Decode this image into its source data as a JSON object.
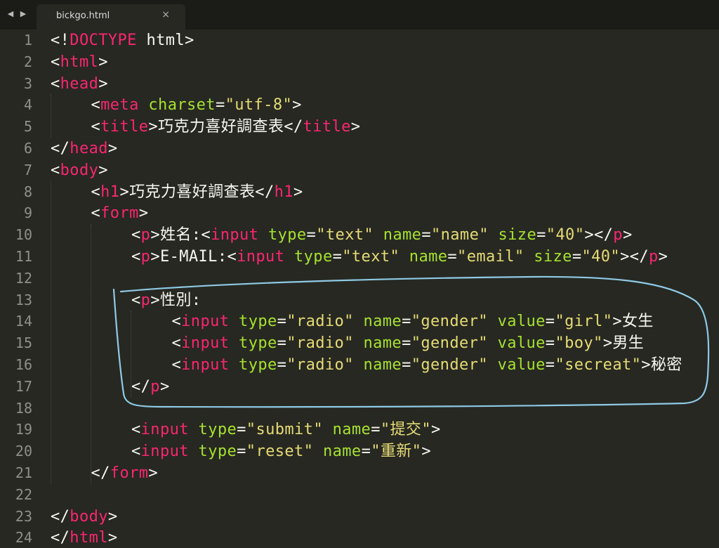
{
  "tab": {
    "title": "bickgo.html",
    "close": "×"
  },
  "nav": {
    "back": "◀",
    "forward": "▶"
  },
  "editor": {
    "lines": [
      {
        "n": "1",
        "indent": 0,
        "tokens": [
          [
            "<!",
            "pl"
          ],
          [
            "DOCTYPE",
            "tg"
          ],
          [
            " html>",
            "pl"
          ]
        ]
      },
      {
        "n": "2",
        "indent": 0,
        "tokens": [
          [
            "<",
            "pl"
          ],
          [
            "html",
            "tg"
          ],
          [
            ">",
            "pl"
          ]
        ]
      },
      {
        "n": "3",
        "indent": 0,
        "tokens": [
          [
            "<",
            "pl"
          ],
          [
            "head",
            "tg"
          ],
          [
            ">",
            "pl"
          ]
        ]
      },
      {
        "n": "4",
        "indent": 1,
        "tokens": [
          [
            "<",
            "pl"
          ],
          [
            "meta",
            "tg"
          ],
          [
            " ",
            "pl"
          ],
          [
            "charset",
            "at"
          ],
          [
            "=",
            "pl"
          ],
          [
            "\"utf-8\"",
            "st"
          ],
          [
            ">",
            "pl"
          ]
        ]
      },
      {
        "n": "5",
        "indent": 1,
        "tokens": [
          [
            "<",
            "pl"
          ],
          [
            "title",
            "tg"
          ],
          [
            ">巧克力喜好調查表</",
            "pl"
          ],
          [
            "title",
            "tg"
          ],
          [
            ">",
            "pl"
          ]
        ]
      },
      {
        "n": "6",
        "indent": 0,
        "tokens": [
          [
            "</",
            "pl"
          ],
          [
            "head",
            "tg"
          ],
          [
            ">",
            "pl"
          ]
        ]
      },
      {
        "n": "7",
        "indent": 0,
        "tokens": [
          [
            "<",
            "pl"
          ],
          [
            "body",
            "tg"
          ],
          [
            ">",
            "pl"
          ]
        ]
      },
      {
        "n": "8",
        "indent": 1,
        "tokens": [
          [
            "<",
            "pl"
          ],
          [
            "h1",
            "tg"
          ],
          [
            ">巧克力喜好調查表</",
            "pl"
          ],
          [
            "h1",
            "tg"
          ],
          [
            ">",
            "pl"
          ]
        ]
      },
      {
        "n": "9",
        "indent": 1,
        "tokens": [
          [
            "<",
            "pl"
          ],
          [
            "form",
            "tg"
          ],
          [
            ">",
            "pl"
          ]
        ]
      },
      {
        "n": "10",
        "indent": 2,
        "tokens": [
          [
            "<",
            "pl"
          ],
          [
            "p",
            "tg"
          ],
          [
            ">姓名:<",
            "pl"
          ],
          [
            "input",
            "tg"
          ],
          [
            " ",
            "pl"
          ],
          [
            "type",
            "at"
          ],
          [
            "=",
            "pl"
          ],
          [
            "\"text\"",
            "st"
          ],
          [
            " ",
            "pl"
          ],
          [
            "name",
            "at"
          ],
          [
            "=",
            "pl"
          ],
          [
            "\"name\"",
            "st"
          ],
          [
            " ",
            "pl"
          ],
          [
            "size",
            "at"
          ],
          [
            "=",
            "pl"
          ],
          [
            "\"40\"",
            "st"
          ],
          [
            "></",
            "pl"
          ],
          [
            "p",
            "tg"
          ],
          [
            ">",
            "pl"
          ]
        ]
      },
      {
        "n": "11",
        "indent": 2,
        "tokens": [
          [
            "<",
            "pl"
          ],
          [
            "p",
            "tg"
          ],
          [
            ">E-MAIL:<",
            "pl"
          ],
          [
            "input",
            "tg"
          ],
          [
            " ",
            "pl"
          ],
          [
            "type",
            "at"
          ],
          [
            "=",
            "pl"
          ],
          [
            "\"text\"",
            "st"
          ],
          [
            " ",
            "pl"
          ],
          [
            "name",
            "at"
          ],
          [
            "=",
            "pl"
          ],
          [
            "\"email\"",
            "st"
          ],
          [
            " ",
            "pl"
          ],
          [
            "size",
            "at"
          ],
          [
            "=",
            "pl"
          ],
          [
            "\"40\"",
            "st"
          ],
          [
            "></",
            "pl"
          ],
          [
            "p",
            "tg"
          ],
          [
            ">",
            "pl"
          ]
        ]
      },
      {
        "n": "12",
        "indent": 0,
        "tokens": []
      },
      {
        "n": "13",
        "indent": 2,
        "tokens": [
          [
            "<",
            "pl"
          ],
          [
            "p",
            "tg"
          ],
          [
            ">性別:",
            "pl"
          ]
        ]
      },
      {
        "n": "14",
        "indent": 3,
        "tokens": [
          [
            "<",
            "pl"
          ],
          [
            "input",
            "tg"
          ],
          [
            " ",
            "pl"
          ],
          [
            "type",
            "at"
          ],
          [
            "=",
            "pl"
          ],
          [
            "\"radio\"",
            "st"
          ],
          [
            " ",
            "pl"
          ],
          [
            "name",
            "at"
          ],
          [
            "=",
            "pl"
          ],
          [
            "\"gender\"",
            "st"
          ],
          [
            " ",
            "pl"
          ],
          [
            "value",
            "at"
          ],
          [
            "=",
            "pl"
          ],
          [
            "\"girl\"",
            "st"
          ],
          [
            ">女生",
            "pl"
          ]
        ]
      },
      {
        "n": "15",
        "indent": 3,
        "tokens": [
          [
            "<",
            "pl"
          ],
          [
            "input",
            "tg"
          ],
          [
            " ",
            "pl"
          ],
          [
            "type",
            "at"
          ],
          [
            "=",
            "pl"
          ],
          [
            "\"radio\"",
            "st"
          ],
          [
            " ",
            "pl"
          ],
          [
            "name",
            "at"
          ],
          [
            "=",
            "pl"
          ],
          [
            "\"gender\"",
            "st"
          ],
          [
            " ",
            "pl"
          ],
          [
            "value",
            "at"
          ],
          [
            "=",
            "pl"
          ],
          [
            "\"boy\"",
            "st"
          ],
          [
            ">男生",
            "pl"
          ]
        ]
      },
      {
        "n": "16",
        "indent": 3,
        "tokens": [
          [
            "<",
            "pl"
          ],
          [
            "input",
            "tg"
          ],
          [
            " ",
            "pl"
          ],
          [
            "type",
            "at"
          ],
          [
            "=",
            "pl"
          ],
          [
            "\"radio\"",
            "st"
          ],
          [
            " ",
            "pl"
          ],
          [
            "name",
            "at"
          ],
          [
            "=",
            "pl"
          ],
          [
            "\"gender\"",
            "st"
          ],
          [
            " ",
            "pl"
          ],
          [
            "value",
            "at"
          ],
          [
            "=",
            "pl"
          ],
          [
            "\"secreat\"",
            "st"
          ],
          [
            ">秘密",
            "pl"
          ]
        ]
      },
      {
        "n": "17",
        "indent": 2,
        "tokens": [
          [
            "</",
            "pl"
          ],
          [
            "p",
            "tg"
          ],
          [
            ">",
            "pl"
          ]
        ]
      },
      {
        "n": "18",
        "indent": 0,
        "tokens": []
      },
      {
        "n": "19",
        "indent": 2,
        "tokens": [
          [
            "<",
            "pl"
          ],
          [
            "input",
            "tg"
          ],
          [
            " ",
            "pl"
          ],
          [
            "type",
            "at"
          ],
          [
            "=",
            "pl"
          ],
          [
            "\"submit\"",
            "st"
          ],
          [
            " ",
            "pl"
          ],
          [
            "name",
            "at"
          ],
          [
            "=",
            "pl"
          ],
          [
            "\"提交\"",
            "st"
          ],
          [
            ">",
            "pl"
          ]
        ]
      },
      {
        "n": "20",
        "indent": 2,
        "tokens": [
          [
            "<",
            "pl"
          ],
          [
            "input",
            "tg"
          ],
          [
            " ",
            "pl"
          ],
          [
            "type",
            "at"
          ],
          [
            "=",
            "pl"
          ],
          [
            "\"reset\"",
            "st"
          ],
          [
            " ",
            "pl"
          ],
          [
            "name",
            "at"
          ],
          [
            "=",
            "pl"
          ],
          [
            "\"重新\"",
            "st"
          ],
          [
            ">",
            "pl"
          ]
        ]
      },
      {
        "n": "21",
        "indent": 1,
        "tokens": [
          [
            "</",
            "pl"
          ],
          [
            "form",
            "tg"
          ],
          [
            ">",
            "pl"
          ]
        ]
      },
      {
        "n": "22",
        "indent": 0,
        "tokens": []
      },
      {
        "n": "23",
        "indent": 0,
        "tokens": [
          [
            "</",
            "pl"
          ],
          [
            "body",
            "tg"
          ],
          [
            ">",
            "pl"
          ]
        ]
      },
      {
        "n": "24",
        "indent": 0,
        "tokens": [
          [
            "</",
            "pl"
          ],
          [
            "html",
            "tg"
          ],
          [
            ">",
            "pl"
          ]
        ]
      }
    ]
  },
  "colors": {
    "background": "#272822",
    "tag": "#f92672",
    "attribute": "#a6e22e",
    "string": "#e6db74",
    "text": "#f8f8f2",
    "gutter": "#8f908a",
    "annotation": "#8ecae6"
  }
}
